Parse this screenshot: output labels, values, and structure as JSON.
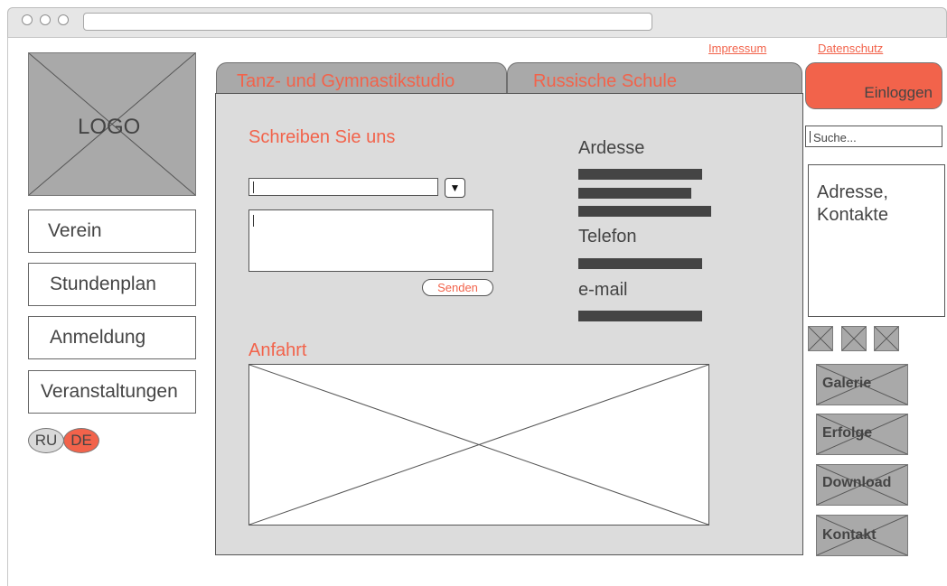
{
  "header": {
    "links": [
      "Impressum",
      "Datenschutz"
    ]
  },
  "logo": {
    "label": "LOGO"
  },
  "sidebar": {
    "items": [
      {
        "label": "Verein"
      },
      {
        "label": "Stundenplan"
      },
      {
        "label": "Anmeldung"
      },
      {
        "label": "Veranstaltungen"
      }
    ],
    "languages": [
      "RU",
      "DE"
    ]
  },
  "tabs": [
    {
      "label": "Tanz- und Gymnastikstudio"
    },
    {
      "label": "Russische Schule"
    }
  ],
  "contact_form": {
    "title": "Schreiben Sie uns",
    "dropdown_arrow": "▼",
    "send_label": "Senden"
  },
  "contact_info": {
    "address_label": "Ardesse",
    "phone_label": "Telefon",
    "email_label": "e-mail"
  },
  "map": {
    "title": "Anfahrt"
  },
  "right": {
    "login_label": "Einloggen",
    "search_placeholder": "Suche...",
    "address_box": "Adresse, Kontakte",
    "buttons": [
      {
        "label": "Galerie"
      },
      {
        "label": "Erfolge"
      },
      {
        "label": "Download"
      },
      {
        "label": "Kontakt"
      }
    ]
  },
  "colors": {
    "accent": "#f2634b",
    "placeholder_gray": "#a9a9a9",
    "panel_gray": "#dcdcdc"
  }
}
